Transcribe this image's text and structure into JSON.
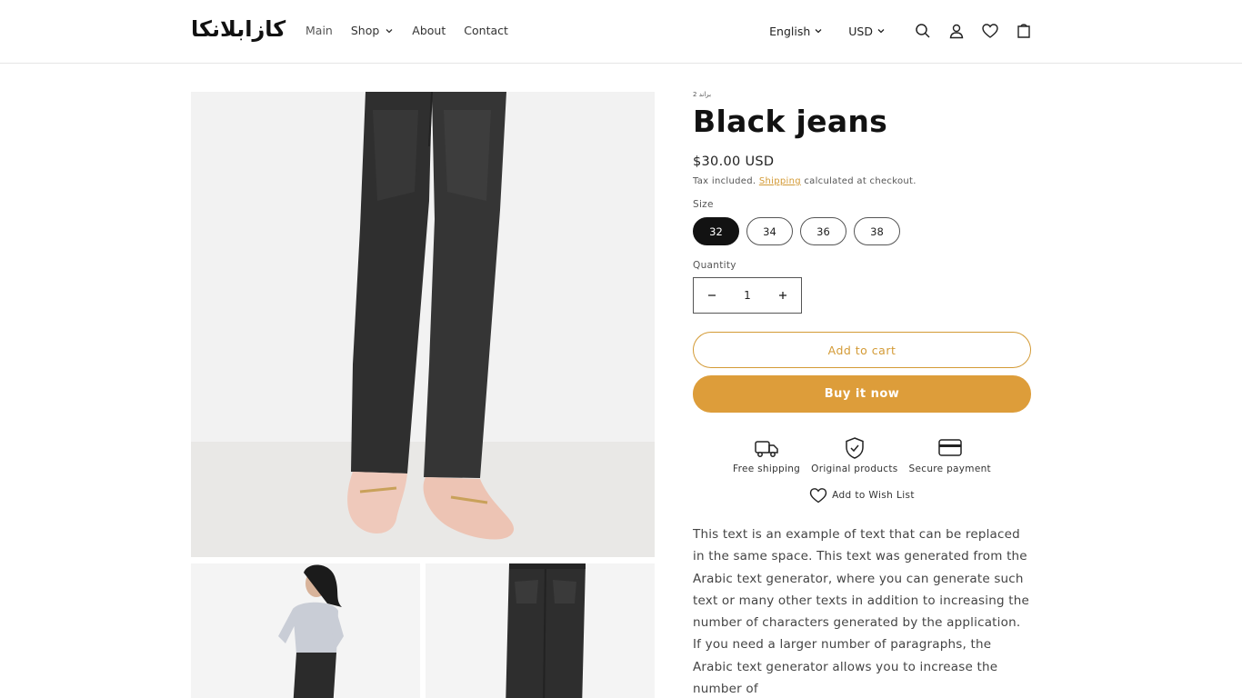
{
  "header": {
    "logo": "كازابلانكا",
    "nav": [
      {
        "label": "Main",
        "has_dropdown": false
      },
      {
        "label": "Shop",
        "has_dropdown": true
      },
      {
        "label": "About",
        "has_dropdown": false
      },
      {
        "label": "Contact",
        "has_dropdown": false
      }
    ],
    "language": "English",
    "currency": "USD",
    "icons": [
      "search-icon",
      "account-icon",
      "heart-icon",
      "cart-icon"
    ]
  },
  "product": {
    "vendor": "براند 2",
    "title": "Black jeans",
    "price": "$30.00 USD",
    "tax_prefix": "Tax included.",
    "tax_link": "Shipping",
    "tax_suffix": "calculated at checkout.",
    "size_label": "Size",
    "sizes": [
      "32",
      "34",
      "36",
      "38"
    ],
    "selected_size": "32",
    "quantity_label": "Quantity",
    "quantity_value": "1",
    "add_to_cart": "Add to cart",
    "buy_now": "Buy it now",
    "features": [
      {
        "icon": "truck-icon",
        "label": "Free shipping"
      },
      {
        "icon": "shield-check-icon",
        "label": "Original products"
      },
      {
        "icon": "credit-card-icon",
        "label": "Secure payment"
      }
    ],
    "wishlist_label": "Add to Wish List",
    "description": [
      "This text is an example of text that can be replaced in the same space. This text was generated from the Arabic text generator, where you can generate such text or many other texts in addition to increasing the number of characters generated by the application.",
      "If you need a larger number of paragraphs, the Arabic text generator allows you to increase the number of"
    ]
  },
  "colors": {
    "accent": "#dd9d3a",
    "accent_text": "#d39a35",
    "dark": "#121212"
  }
}
